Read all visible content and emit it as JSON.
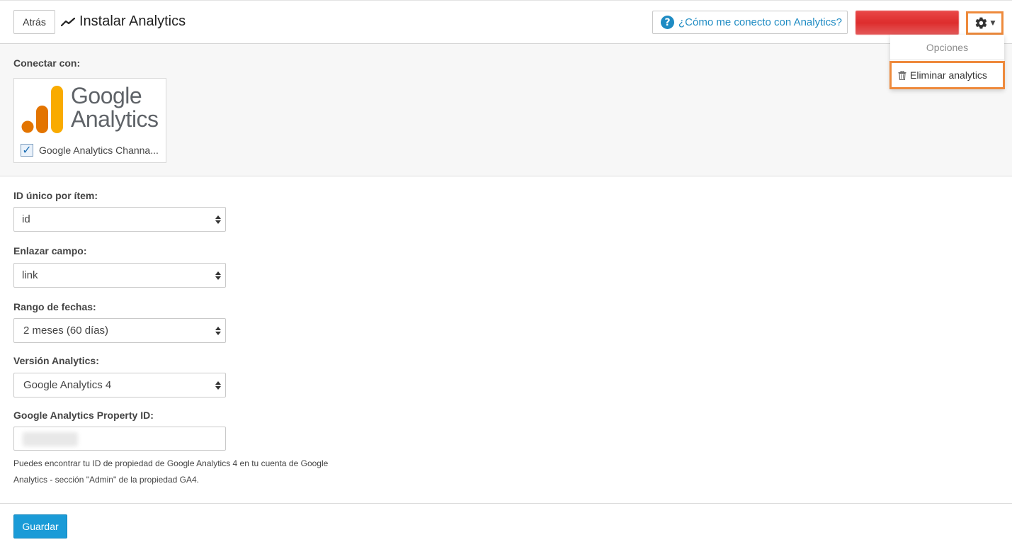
{
  "header": {
    "back_label": "Atrás",
    "title": "Instalar Analytics",
    "help_label": "¿Cómo me conecto con Analytics?",
    "accent_color": "#1e8bc3",
    "highlight_color": "#ee8a3c"
  },
  "options_menu": {
    "header": "Opciones",
    "items": [
      {
        "label": "Eliminar analytics",
        "icon": "trash-icon"
      }
    ]
  },
  "connect": {
    "label": "Conectar con:",
    "service": {
      "logo_text_line1": "Google",
      "logo_text_line2": "Analytics",
      "checkbox_label": "Google Analytics Channa...",
      "checked": true
    }
  },
  "form": {
    "unique_id": {
      "label": "ID único por ítem:",
      "value": "id"
    },
    "link_field": {
      "label": "Enlazar campo:",
      "value": "link"
    },
    "date_range": {
      "label": "Rango de fechas:",
      "value": "2 meses (60 días)"
    },
    "version": {
      "label": "Versión Analytics:",
      "value": "Google Analytics 4"
    },
    "property_id": {
      "label": "Google Analytics Property ID:",
      "help_line1": "Puedes encontrar tu ID de propiedad de Google Analytics 4 en tu cuenta de Google",
      "help_line2": "Analytics - sección \"Admin\" de la propiedad GA4."
    }
  },
  "footer": {
    "save_label": "Guardar",
    "save_color": "#1a9bd7"
  }
}
